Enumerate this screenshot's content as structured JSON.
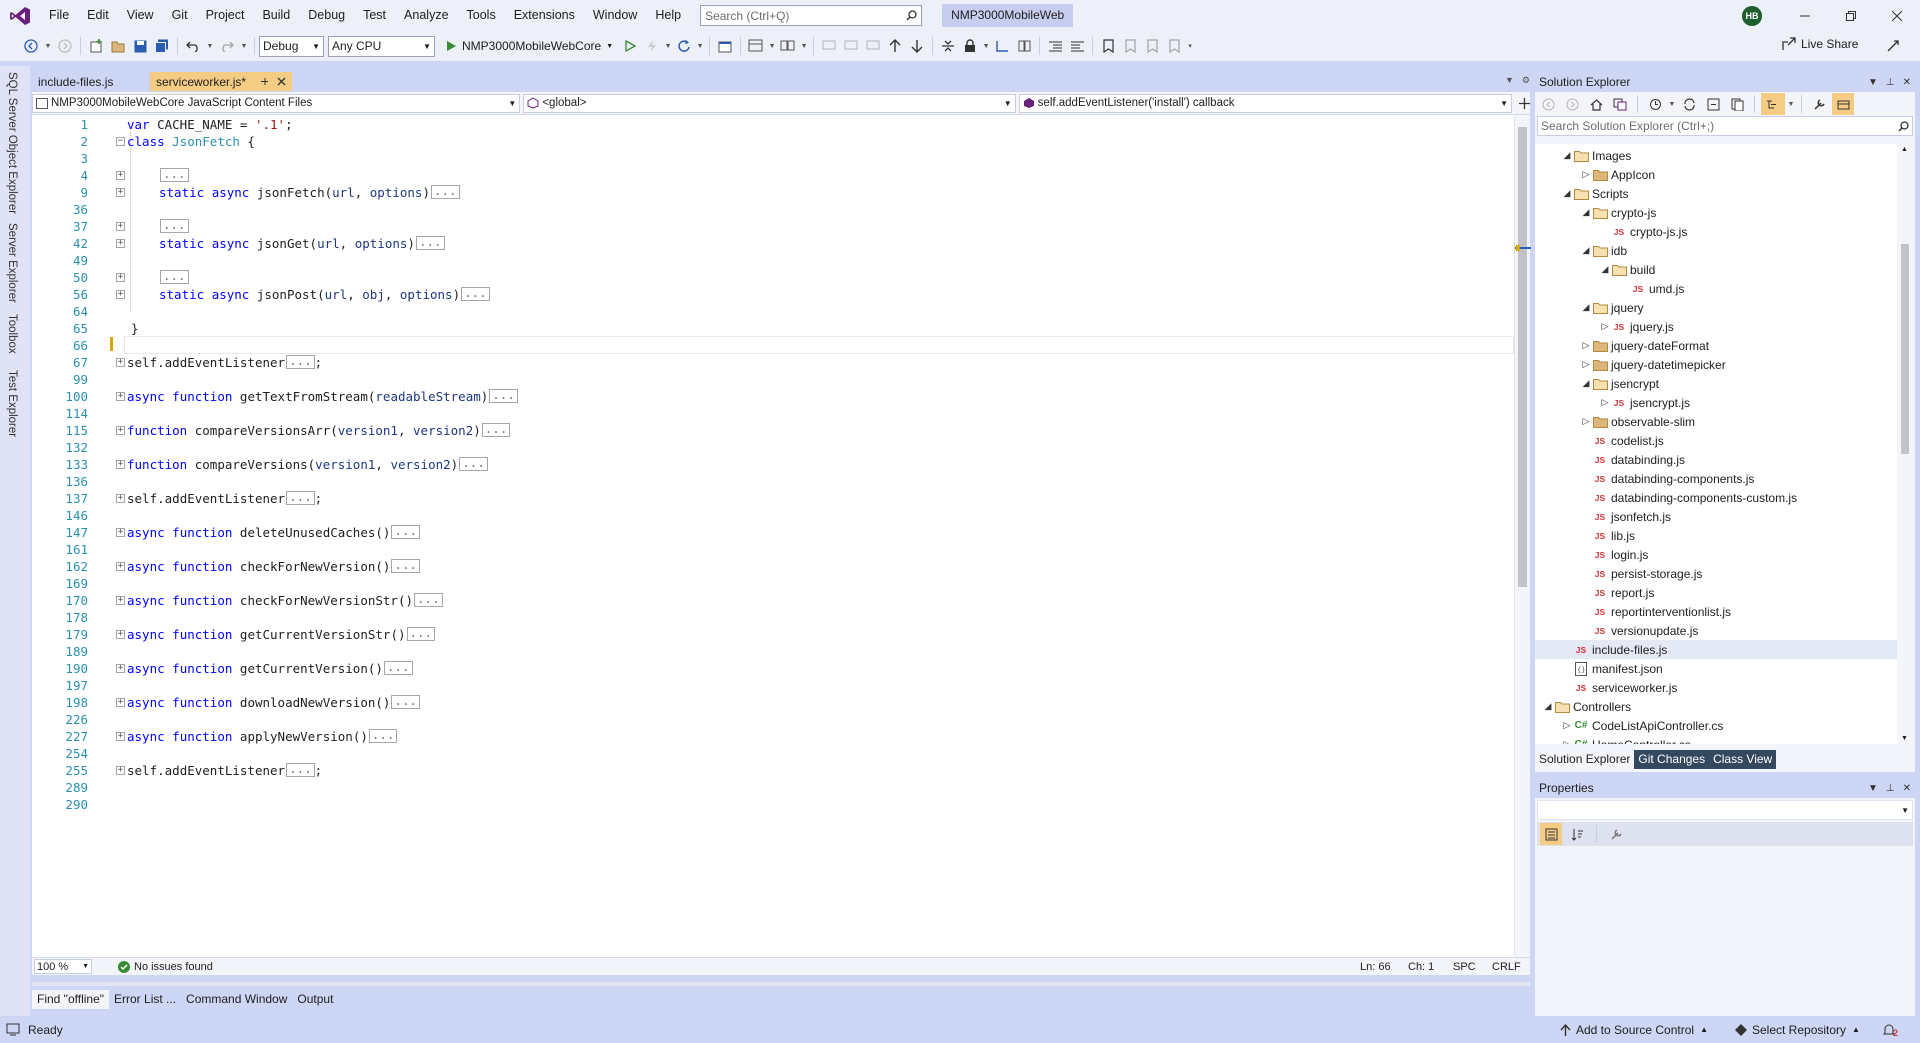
{
  "menu": [
    "File",
    "Edit",
    "View",
    "Git",
    "Project",
    "Build",
    "Debug",
    "Test",
    "Analyze",
    "Tools",
    "Extensions",
    "Window",
    "Help"
  ],
  "search": {
    "placeholder": "Search (Ctrl+Q)"
  },
  "solution_title": "NMP3000MobileWeb",
  "user_initials": "HB",
  "toolbar": {
    "config": "Debug",
    "platform": "Any CPU",
    "run_target": "NMP3000MobileWebCore",
    "live_share": "Live Share"
  },
  "side_tabs": [
    "SQL Server Object Explorer",
    "Server Explorer",
    "Toolbox",
    "Test Explorer"
  ],
  "doc_tabs": [
    {
      "label": "include-files.js"
    },
    {
      "label": "serviceworker.js*"
    }
  ],
  "nav": {
    "project": "NMP3000MobileWebCore JavaScript Content Files",
    "scope": "<global>",
    "member": "self.addEventListener('install') callback"
  },
  "code_lines": [
    {
      "num": "1",
      "text": "var CACHE_NAME = '.1';"
    },
    {
      "num": "2",
      "text": "class JsonFetch {"
    },
    {
      "num": "3",
      "text": ""
    },
    {
      "num": "4",
      "text": "..."
    },
    {
      "num": "9",
      "text": "static async jsonFetch(url, options)"
    },
    {
      "num": "36",
      "text": ""
    },
    {
      "num": "37",
      "text": "..."
    },
    {
      "num": "42",
      "text": "static async jsonGet(url, options)"
    },
    {
      "num": "49",
      "text": ""
    },
    {
      "num": "50",
      "text": "..."
    },
    {
      "num": "56",
      "text": "static async jsonPost(url, obj, options)"
    },
    {
      "num": "64",
      "text": ""
    },
    {
      "num": "65",
      "text": "}"
    },
    {
      "num": "66",
      "text": ""
    },
    {
      "num": "67",
      "text": "self.addEventListener"
    },
    {
      "num": "99",
      "text": ""
    },
    {
      "num": "100",
      "text": "async function getTextFromStream(readableStream)"
    },
    {
      "num": "114",
      "text": ""
    },
    {
      "num": "115",
      "text": "function compareVersionsArr(version1, version2)"
    },
    {
      "num": "132",
      "text": ""
    },
    {
      "num": "133",
      "text": "function compareVersions(version1, version2)"
    },
    {
      "num": "136",
      "text": ""
    },
    {
      "num": "137",
      "text": "self.addEventListener"
    },
    {
      "num": "146",
      "text": ""
    },
    {
      "num": "147",
      "text": "async function deleteUnusedCaches()"
    },
    {
      "num": "161",
      "text": ""
    },
    {
      "num": "162",
      "text": "async function checkForNewVersion()"
    },
    {
      "num": "169",
      "text": ""
    },
    {
      "num": "170",
      "text": "async function checkForNewVersionStr()"
    },
    {
      "num": "178",
      "text": ""
    },
    {
      "num": "179",
      "text": "async function getCurrentVersionStr()"
    },
    {
      "num": "189",
      "text": ""
    },
    {
      "num": "190",
      "text": "async function getCurrentVersion()"
    },
    {
      "num": "197",
      "text": ""
    },
    {
      "num": "198",
      "text": "async function downloadNewVersion()"
    },
    {
      "num": "226",
      "text": ""
    },
    {
      "num": "227",
      "text": "async function applyNewVersion()"
    },
    {
      "num": "254",
      "text": ""
    },
    {
      "num": "255",
      "text": "self.addEventListener"
    },
    {
      "num": "289",
      "text": ""
    },
    {
      "num": "290",
      "text": ""
    }
  ],
  "editor_status": {
    "zoom": "100 %",
    "issues": "No issues found",
    "line": "Ln: 66",
    "col": "Ch: 1",
    "ws": "SPC",
    "eol": "CRLF"
  },
  "bottom_tabs": [
    "Find \"offline\"",
    "Error List ...",
    "Command Window",
    "Output"
  ],
  "solution_explorer": {
    "title": "Solution Explorer",
    "search_placeholder": "Search Solution Explorer (Ctrl+;)",
    "tree": [
      {
        "label": "Images",
        "depth": 2,
        "exp": "open",
        "icon": "folder"
      },
      {
        "label": "AppIcon",
        "depth": 3,
        "exp": "closed",
        "icon": "folder"
      },
      {
        "label": "Scripts",
        "depth": 2,
        "exp": "open",
        "icon": "folder"
      },
      {
        "label": "crypto-js",
        "depth": 3,
        "exp": "open",
        "icon": "folder"
      },
      {
        "label": "crypto-js.js",
        "depth": 4,
        "exp": "",
        "icon": "js"
      },
      {
        "label": "idb",
        "depth": 3,
        "exp": "open",
        "icon": "folder"
      },
      {
        "label": "build",
        "depth": 4,
        "exp": "open",
        "icon": "folder"
      },
      {
        "label": "umd.js",
        "depth": 5,
        "exp": "",
        "icon": "js"
      },
      {
        "label": "jquery",
        "depth": 3,
        "exp": "open",
        "icon": "folder"
      },
      {
        "label": "jquery.js",
        "depth": 4,
        "exp": "closed",
        "icon": "js"
      },
      {
        "label": "jquery-dateFormat",
        "depth": 3,
        "exp": "closed",
        "icon": "folder"
      },
      {
        "label": "jquery-datetimepicker",
        "depth": 3,
        "exp": "closed",
        "icon": "folder"
      },
      {
        "label": "jsencrypt",
        "depth": 3,
        "exp": "open",
        "icon": "folder"
      },
      {
        "label": "jsencrypt.js",
        "depth": 4,
        "exp": "closed",
        "icon": "js"
      },
      {
        "label": "observable-slim",
        "depth": 3,
        "exp": "closed",
        "icon": "folder"
      },
      {
        "label": "codelist.js",
        "depth": 3,
        "exp": "",
        "icon": "js"
      },
      {
        "label": "databinding.js",
        "depth": 3,
        "exp": "",
        "icon": "js"
      },
      {
        "label": "databinding-components.js",
        "depth": 3,
        "exp": "",
        "icon": "js"
      },
      {
        "label": "databinding-components-custom.js",
        "depth": 3,
        "exp": "",
        "icon": "js"
      },
      {
        "label": "jsonfetch.js",
        "depth": 3,
        "exp": "",
        "icon": "js"
      },
      {
        "label": "lib.js",
        "depth": 3,
        "exp": "",
        "icon": "js"
      },
      {
        "label": "login.js",
        "depth": 3,
        "exp": "",
        "icon": "js"
      },
      {
        "label": "persist-storage.js",
        "depth": 3,
        "exp": "",
        "icon": "js"
      },
      {
        "label": "report.js",
        "depth": 3,
        "exp": "",
        "icon": "js"
      },
      {
        "label": "reportinterventionlist.js",
        "depth": 3,
        "exp": "",
        "icon": "js"
      },
      {
        "label": "versionupdate.js",
        "depth": 3,
        "exp": "",
        "icon": "js"
      },
      {
        "label": "include-files.js",
        "depth": 2,
        "exp": "",
        "icon": "js",
        "selected": true
      },
      {
        "label": "manifest.json",
        "depth": 2,
        "exp": "",
        "icon": "json"
      },
      {
        "label": "serviceworker.js",
        "depth": 2,
        "exp": "",
        "icon": "js"
      },
      {
        "label": "Controllers",
        "depth": 1,
        "exp": "open",
        "icon": "folder"
      },
      {
        "label": "CodeListApiController.cs",
        "depth": 2,
        "exp": "closed",
        "icon": "cs"
      },
      {
        "label": "HomeController.cs",
        "depth": 2,
        "exp": "closed",
        "icon": "cs"
      }
    ],
    "tabs": [
      "Solution Explorer",
      "Git Changes",
      "Class View"
    ]
  },
  "properties": {
    "title": "Properties"
  },
  "status": {
    "ready": "Ready",
    "source_control": "Add to Source Control",
    "repo": "Select Repository",
    "notifications": "2"
  },
  "colors": {
    "accent": "#68217a",
    "active_tab": "#f5cc84",
    "run_green": "#388a34"
  }
}
